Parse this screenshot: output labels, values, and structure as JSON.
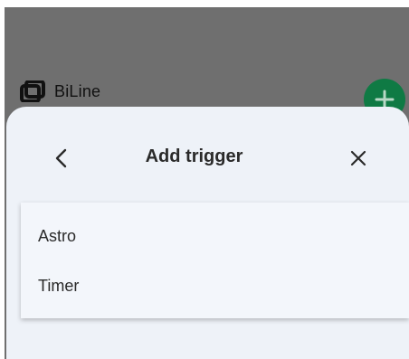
{
  "app": {
    "name": "BiLine"
  },
  "sheet": {
    "title": "Add trigger",
    "options": [
      {
        "label": "Astro"
      },
      {
        "label": "Timer"
      }
    ]
  },
  "icons": {
    "back": "chevron-left-icon",
    "close": "close-icon",
    "logo": "biline-logo-icon",
    "fab": "plus-icon"
  },
  "colors": {
    "backdrop": "#6f6f6f",
    "fab": "#0f7a44",
    "sheet_bg": "#eef2f8",
    "card_bg": "#f3f6fb",
    "text": "#2a2a2a"
  }
}
